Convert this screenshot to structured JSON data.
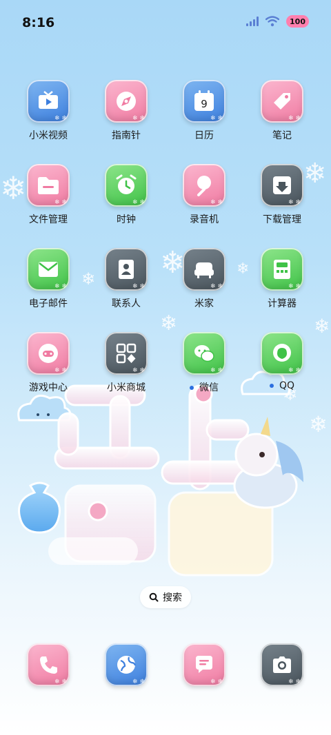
{
  "status_bar": {
    "time": "8:16",
    "battery": "100"
  },
  "apps": [
    {
      "label": "小米视频",
      "icon": "tv-play-icon",
      "color": "blue"
    },
    {
      "label": "指南针",
      "icon": "compass-icon",
      "color": "pink"
    },
    {
      "label": "日历",
      "icon": "calendar-icon",
      "color": "blue",
      "day": "9"
    },
    {
      "label": "笔记",
      "icon": "note-tag-icon",
      "color": "pink"
    },
    {
      "label": "文件管理",
      "icon": "folder-icon",
      "color": "pink"
    },
    {
      "label": "时钟",
      "icon": "alarm-clock-icon",
      "color": "green"
    },
    {
      "label": "录音机",
      "icon": "microphone-icon",
      "color": "pink"
    },
    {
      "label": "下载管理",
      "icon": "download-icon",
      "color": "gray"
    },
    {
      "label": "电子邮件",
      "icon": "mail-icon",
      "color": "green"
    },
    {
      "label": "联系人",
      "icon": "contacts-icon",
      "color": "gray"
    },
    {
      "label": "米家",
      "icon": "sofa-icon",
      "color": "gray"
    },
    {
      "label": "计算器",
      "icon": "calculator-icon",
      "color": "green"
    },
    {
      "label": "游戏中心",
      "icon": "gamepad-icon",
      "color": "pink"
    },
    {
      "label": "小米商城",
      "icon": "store-grid-icon",
      "color": "gray"
    },
    {
      "label": "微信",
      "icon": "wechat-icon",
      "color": "green",
      "new_dot": true
    },
    {
      "label": "QQ",
      "icon": "qq-icon",
      "color": "green",
      "new_dot": true
    }
  ],
  "search": {
    "label": "搜索"
  },
  "dock": [
    {
      "icon": "phone-icon",
      "color": "pink"
    },
    {
      "icon": "browser-icon",
      "color": "blue"
    },
    {
      "icon": "messages-icon",
      "color": "pink"
    },
    {
      "icon": "camera-icon",
      "color": "gray"
    }
  ],
  "colors": {
    "blue": "#3d7fde",
    "pink": "#f07ba2",
    "green": "#3fc247",
    "gray": "#4a555d",
    "badge": "#ff7fae"
  }
}
